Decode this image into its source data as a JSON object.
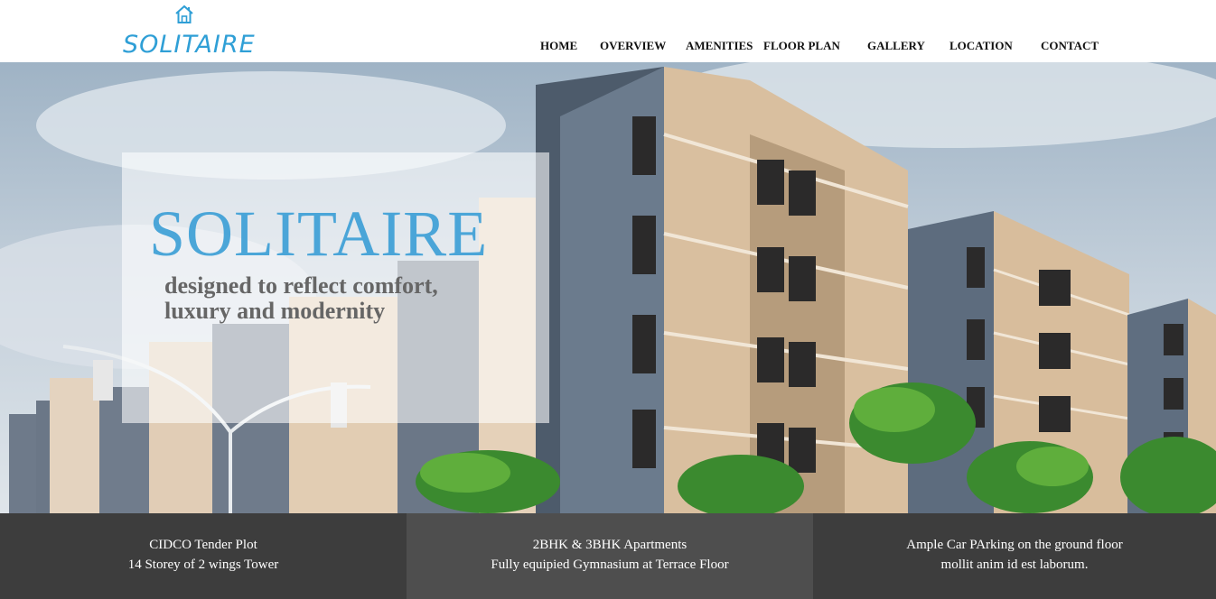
{
  "brand": {
    "name": "SOLITAIRE",
    "icon": "house-icon",
    "color": "#2f9fd6"
  },
  "nav": {
    "items": [
      {
        "label": "HOME"
      },
      {
        "label": "OVERVIEW"
      },
      {
        "label": "AMENITIES"
      },
      {
        "label": "FLOOR PLAN"
      },
      {
        "label": "GALLERY"
      },
      {
        "label": "LOCATION"
      },
      {
        "label": "CONTACT"
      }
    ]
  },
  "hero": {
    "title": "SOLITAIRE",
    "subtitle_line1": "designed to reflect comfort,",
    "subtitle_line2": "luxury and modernity",
    "title_color": "#3a9ed6"
  },
  "features": [
    {
      "line1": "CIDCO Tender Plot",
      "line2": "14 Storey of 2 wings Tower"
    },
    {
      "line1": "2BHK & 3BHK Apartments",
      "line2": "Fully equipied Gymnasium at Terrace Floor"
    },
    {
      "line1": "Ample Car PArking on the ground floor",
      "line2": "mollit anim id est laborum."
    }
  ]
}
